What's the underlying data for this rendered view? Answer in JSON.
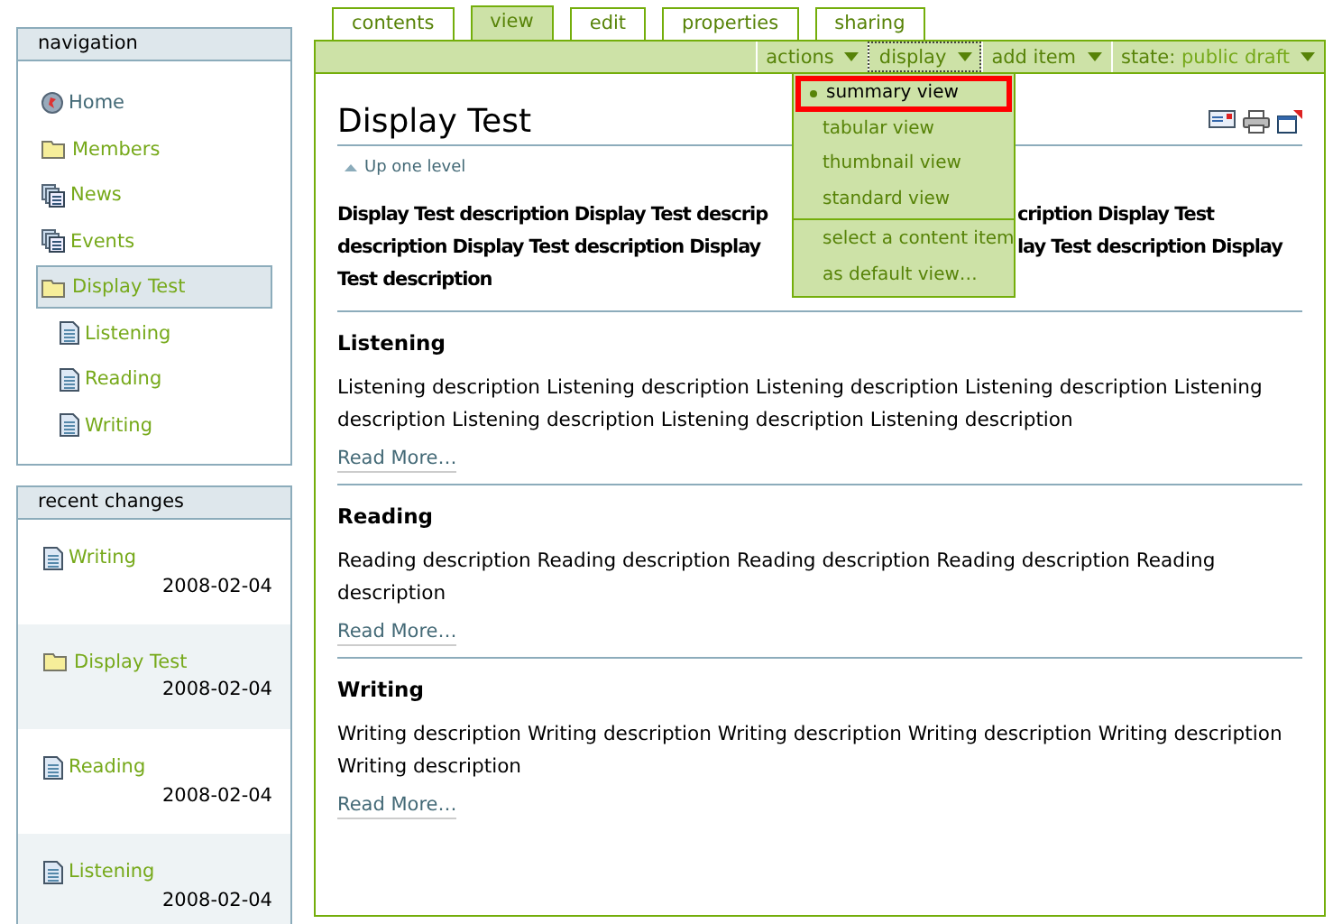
{
  "navigation": {
    "title": "navigation",
    "items": [
      {
        "label": "Home",
        "kind": "home",
        "selected": false
      },
      {
        "label": "Members",
        "kind": "folder",
        "selected": false
      },
      {
        "label": "News",
        "kind": "collection",
        "selected": false
      },
      {
        "label": "Events",
        "kind": "collection",
        "selected": false
      },
      {
        "label": "Display Test",
        "kind": "folder",
        "selected": true,
        "children": [
          {
            "label": "Listening",
            "kind": "page",
            "selected": false
          },
          {
            "label": "Reading",
            "kind": "page",
            "selected": false
          },
          {
            "label": "Writing",
            "kind": "page",
            "selected": false
          }
        ]
      }
    ]
  },
  "recent_changes": {
    "title": "recent changes",
    "items": [
      {
        "label": "Writing",
        "kind": "page",
        "date": "2008-02-04"
      },
      {
        "label": "Display Test",
        "kind": "folder",
        "date": "2008-02-04"
      },
      {
        "label": "Reading",
        "kind": "page",
        "date": "2008-02-04"
      },
      {
        "label": "Listening",
        "kind": "page",
        "date": "2008-02-04"
      }
    ]
  },
  "tabs": [
    {
      "label": "contents",
      "selected": false
    },
    {
      "label": "view",
      "selected": true
    },
    {
      "label": "edit",
      "selected": false
    },
    {
      "label": "properties",
      "selected": false
    },
    {
      "label": "sharing",
      "selected": false
    }
  ],
  "action_menus": [
    {
      "label": "actions",
      "open": false
    },
    {
      "label": "display",
      "open": true
    },
    {
      "label": "add item",
      "open": false
    }
  ],
  "state_menu": {
    "label": "state:",
    "value": "public draft"
  },
  "display_menu": {
    "sections": [
      [
        {
          "label": "summary view",
          "selected": true
        },
        {
          "label": "tabular view",
          "selected": false
        },
        {
          "label": "thumbnail view",
          "selected": false
        },
        {
          "label": "standard view",
          "selected": false
        }
      ],
      [
        {
          "label": "select a content item",
          "selected": false
        },
        {
          "label": "as default view…",
          "selected": false
        }
      ]
    ]
  },
  "page": {
    "title": "Display Test",
    "up_link": "Up one level",
    "description_lines": [
      {
        "left": "Display Test description Display Test descrip",
        "right": "cription Display Test"
      },
      {
        "left": "description Display Test description Display",
        "right": "lay Test description Display"
      },
      {
        "left": "Test description"
      }
    ],
    "entries": [
      {
        "title": "Listening",
        "description": "Listening description Listening description Listening description Listening description Listening description Listening description Listening description Listening description",
        "link": "Read More…"
      },
      {
        "title": "Reading",
        "description": "Reading description Reading description Reading description Reading description Reading description",
        "link": "Read More…"
      },
      {
        "title": "Writing",
        "description": "Writing description Writing description Writing description Writing description Writing description Writing description",
        "link": "Read More…"
      }
    ]
  }
}
